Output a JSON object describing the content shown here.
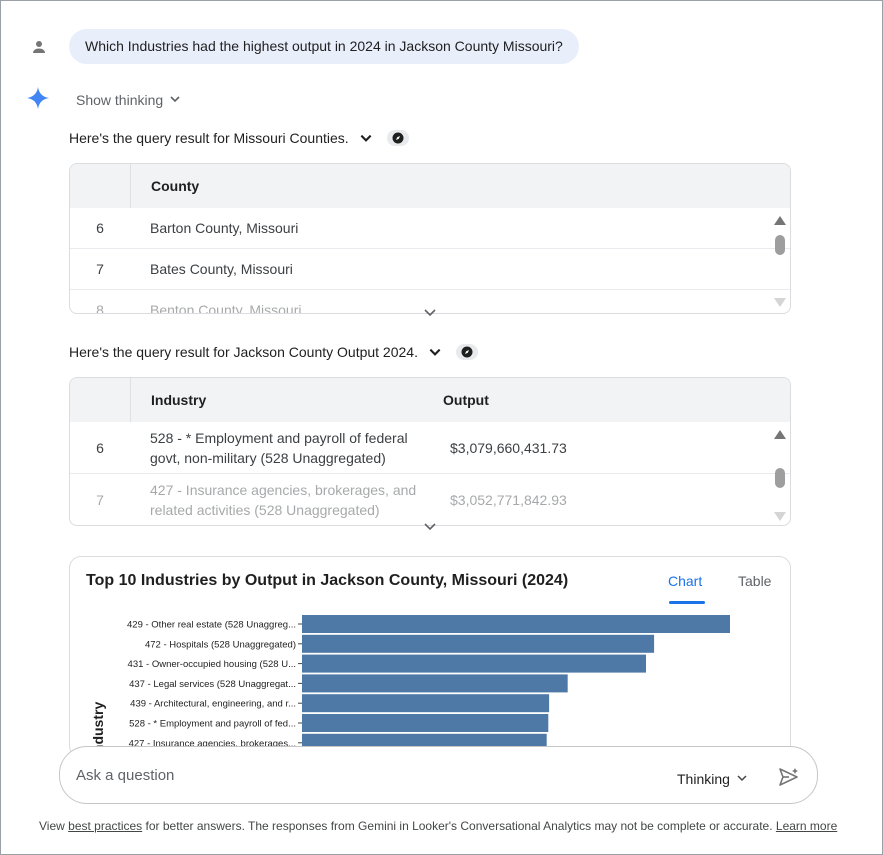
{
  "conversation": {
    "user_question": "Which Industries had the highest output in 2024 in Jackson County Missouri?",
    "show_thinking_label": "Show thinking"
  },
  "result1": {
    "heading": "Here's the query result for Missouri Counties.",
    "column": "County",
    "rows": [
      {
        "idx": "6",
        "county": "Barton County, Missouri"
      },
      {
        "idx": "7",
        "county": "Bates County, Missouri"
      },
      {
        "idx": "8",
        "county": "Benton County, Missouri"
      }
    ]
  },
  "result2": {
    "heading": "Here's the query result for Jackson County Output 2024.",
    "columns": [
      "Industry",
      "Output"
    ],
    "rows": [
      {
        "idx": "6",
        "industry": "528 - * Employment and payroll of federal govt, non-military (528 Unaggregated)",
        "output": "$3,079,660,431.73"
      },
      {
        "idx": "7",
        "industry": "427 - Insurance agencies, brokerages, and related activities (528 Unaggregated)",
        "output": "$3,052,771,842.93"
      }
    ]
  },
  "chart_card": {
    "tab_chart": "Chart",
    "tab_table": "Table"
  },
  "chart_data": {
    "type": "bar",
    "orientation": "horizontal",
    "title": "Top 10 Industries by Output in Jackson County, Missouri (2024)",
    "ylabel": "Industry",
    "color": "#4e79a7",
    "categories": [
      "429 - Other real estate (528 Unaggreg...",
      "472 - Hospitals (528 Unaggregated)",
      "431 - Owner-occupied housing (528 U...",
      "437 - Legal services (528 Unaggregat...",
      "439 - Architectural, engineering, and r...",
      "528 - * Employment and payroll of fed...",
      "427 - Insurance agencies, brokerages..."
    ],
    "values": [
      5.3,
      4.36,
      4.26,
      3.29,
      3.06,
      3.05,
      3.03
    ]
  },
  "composer": {
    "placeholder": "Ask a question",
    "mode_label": "Thinking"
  },
  "footer": {
    "prefix": "View ",
    "link1": "best practices",
    "middle": " for better answers. The responses from Gemini in Looker's Conversational Analytics may not be complete or accurate. ",
    "link2": "Learn more"
  }
}
